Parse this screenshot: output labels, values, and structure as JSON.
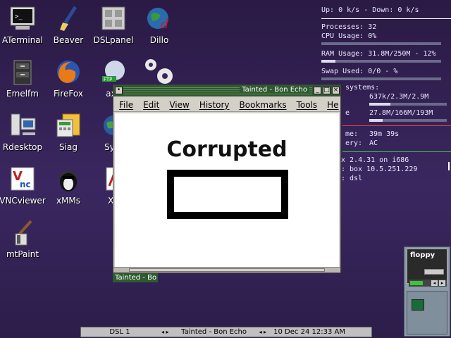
{
  "desktop_icons": [
    {
      "label": "ATerminal",
      "icon": "terminal-icon"
    },
    {
      "label": "Beaver",
      "icon": "paintbrush-icon"
    },
    {
      "label": "DSLpanel",
      "icon": "control-panel-icon"
    },
    {
      "label": "Dillo",
      "icon": "globe-icon"
    },
    {
      "label": "Emelfm",
      "icon": "file-cabinet-icon"
    },
    {
      "label": "FireFox",
      "icon": "firefox-icon"
    },
    {
      "label": "axy",
      "icon": "ftp-icon"
    },
    {
      "label": "Rdesktop",
      "icon": "computers-icon"
    },
    {
      "label": "Siag",
      "icon": "spreadsheet-icon"
    },
    {
      "label": "Sylp",
      "icon": "mail-globe-icon"
    },
    {
      "label": "VNCviewer",
      "icon": "vnc-icon"
    },
    {
      "label": "xMMs",
      "icon": "penguin-headphones-icon"
    },
    {
      "label": "Xp",
      "icon": "pdf-icon"
    },
    {
      "label": "mtPaint",
      "icon": "paint-tools-icon"
    }
  ],
  "conky": {
    "net": "Up: 0 k/s - Down: 0 k/s",
    "processes": "Processes: 32",
    "cpu": "CPU Usage: 0%",
    "cpu_fraction": 0.0,
    "ram": "RAM Usage: 31.8M/250M - 12%",
    "ram_fraction": 0.12,
    "swap": "Swap Used: 0/0 - %",
    "swap_fraction": 0.0,
    "fs_label": "systems:",
    "fs1": "637k/2.3M/2.9M",
    "fs1_fraction": 0.27,
    "fs2_label": "e",
    "fs2": "27.8M/166M/193M",
    "fs2_fraction": 0.17,
    "uptime_label": "me:",
    "uptime": "39m 39s",
    "battery_label": "ery:",
    "battery": "AC",
    "kernel": "x 2.4.31 on i686",
    "host": ": box 10.5.251.229",
    "user": ": dsl"
  },
  "window": {
    "title": "Tainted - Bon Echo",
    "menu": [
      "File",
      "Edit",
      "View",
      "History",
      "Bookmarks",
      "Tools",
      "He"
    ],
    "heading": "Corrupted",
    "minimize": "_",
    "maximize": "□",
    "close": "×",
    "sysmenu": "•"
  },
  "window_label": "Tainted - Bo",
  "taskbar": {
    "desk": "DSL 1",
    "task": "Tainted - Bon Echo",
    "clock": "10 Dec 24 12:33 AM",
    "arrows": "◂ ▸"
  },
  "dock": {
    "label": "floppy"
  },
  "colors": {
    "titlebar": "#2f5a2f",
    "background": "#3a2760"
  }
}
